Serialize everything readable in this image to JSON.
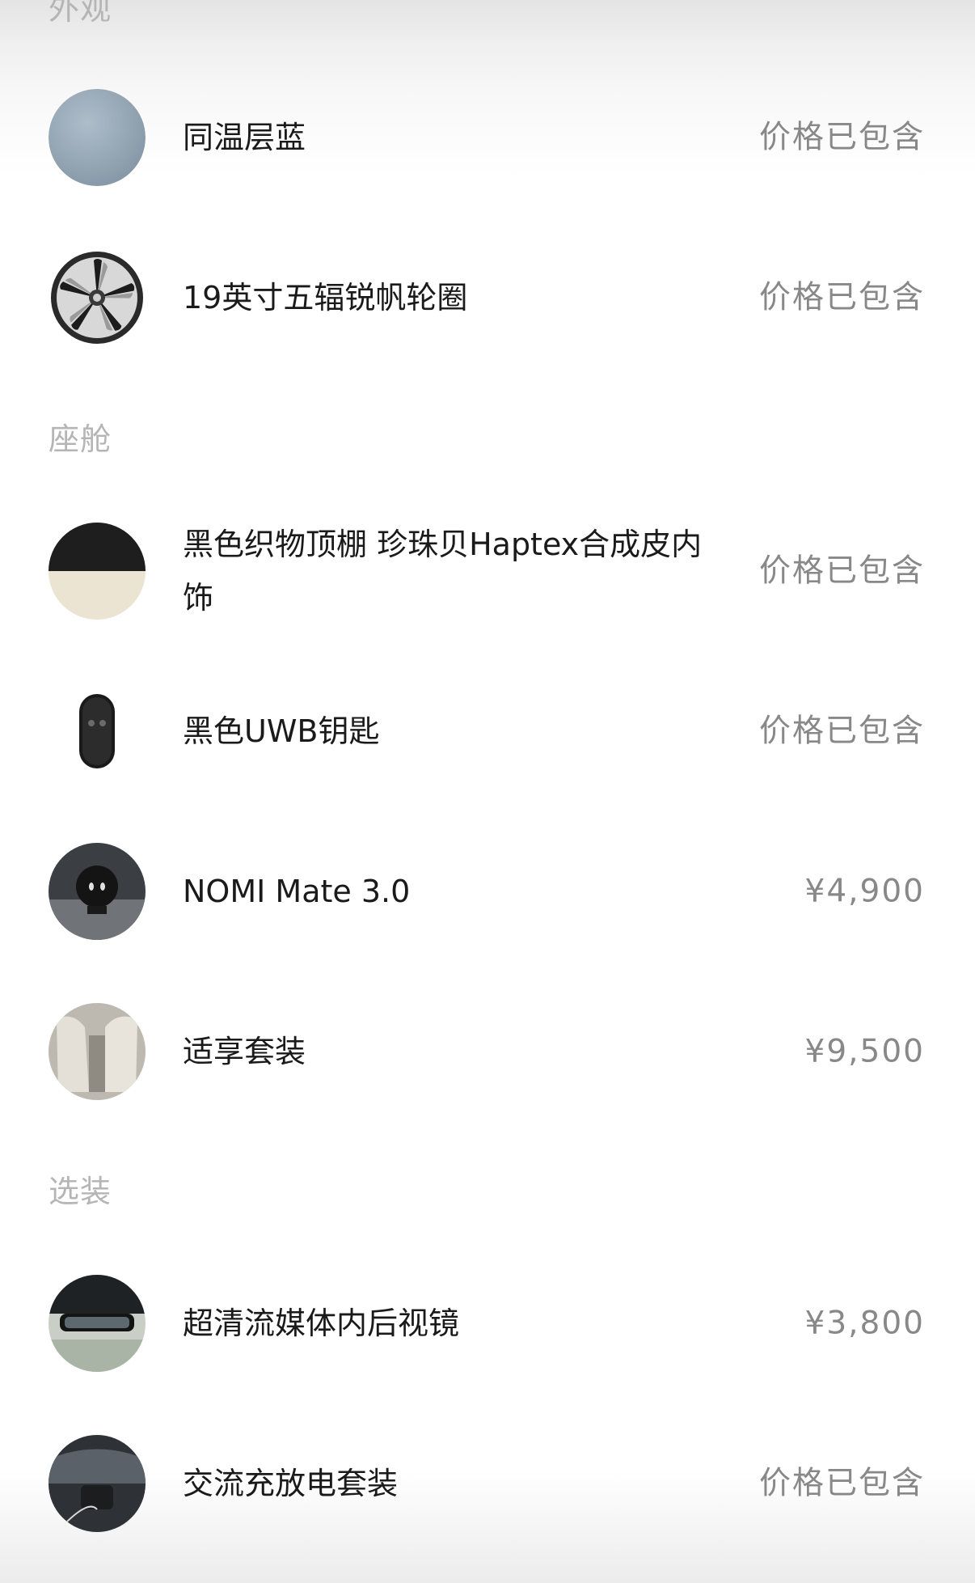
{
  "sections": [
    {
      "title": "外观"
    },
    {
      "title": "座舱"
    },
    {
      "title": "选装"
    }
  ],
  "items": [
    {
      "name": "同温层蓝",
      "price": "价格已包含",
      "icon": "blue-color-swatch-icon"
    },
    {
      "name": "19英寸五辐锐帆轮圈",
      "price": "价格已包含",
      "icon": "wheel-rim-icon"
    },
    {
      "name": "黑色织物顶棚 珍珠贝Haptex合成皮内饰",
      "price": "价格已包含",
      "icon": "interior-color-swatch-icon"
    },
    {
      "name": "黑色UWB钥匙",
      "price": "价格已包含",
      "icon": "uwb-key-icon"
    },
    {
      "name": "NOMI Mate 3.0",
      "price": "¥4,900",
      "icon": "nomi-mate-icon"
    },
    {
      "name": "适享套装",
      "price": "¥9,500",
      "icon": "seat-package-icon"
    },
    {
      "name": "超清流媒体内后视镜",
      "price": "¥3,800",
      "icon": "rearview-mirror-icon"
    },
    {
      "name": "交流充放电套装",
      "price": "价格已包含",
      "icon": "charging-kit-icon"
    }
  ],
  "colors": {
    "section_title": "#b5b5b5",
    "item_text": "#1a1a1a",
    "price_text": "#888888",
    "exterior_blue": "#97a8b6"
  }
}
